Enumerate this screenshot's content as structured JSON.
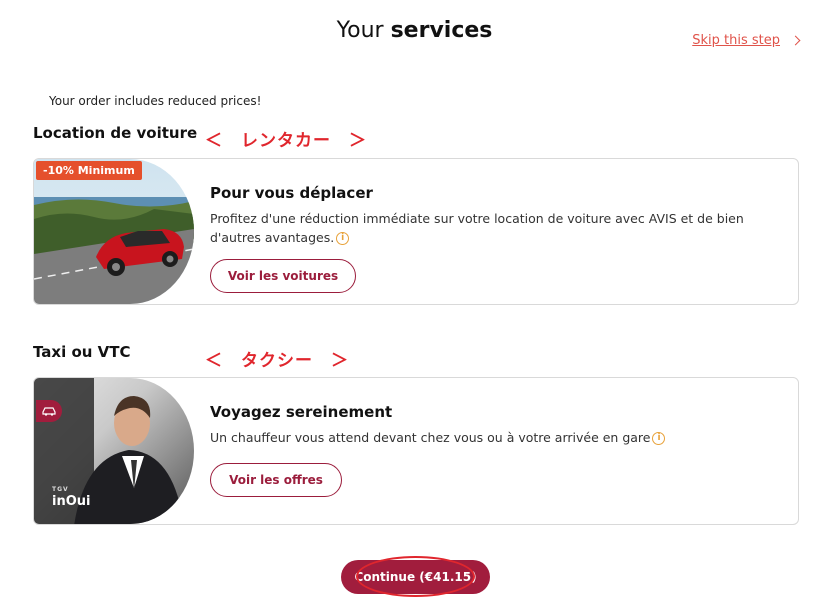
{
  "header": {
    "title_plain": "Your",
    "title_bold": "services",
    "skip_label": "Skip this step"
  },
  "notice": "Your order includes reduced prices!",
  "sections": [
    {
      "title": "Location de voiture",
      "annotation": "＜　レンタカー　＞",
      "card": {
        "badge": "-10% Minimum",
        "heading": "Pour vous déplacer",
        "description": "Profitez d'une réduction immédiate sur votre location de voiture avec AVIS et de bien d'autres avantages.",
        "button_label": "Voir les voitures",
        "image_icon": "car-photo"
      }
    },
    {
      "title": "Taxi ou VTC",
      "annotation": "＜　タクシー　＞",
      "card": {
        "heading": "Voyagez sereinement",
        "description": "Un chauffeur vous attend devant chez vous ou à votre arrivée en gare",
        "button_label": "Voir les offres",
        "brand_small": "TGV",
        "brand": "inOui",
        "image_icon": "chauffeur-photo"
      }
    }
  ],
  "footer": {
    "continue_label": "Continue (€41.15)"
  },
  "colors": {
    "primary": "#a11d3d",
    "accent_orange": "#e5502c",
    "link": "#e0534a",
    "annotation_red": "#e0262d"
  },
  "info_glyph": "i"
}
